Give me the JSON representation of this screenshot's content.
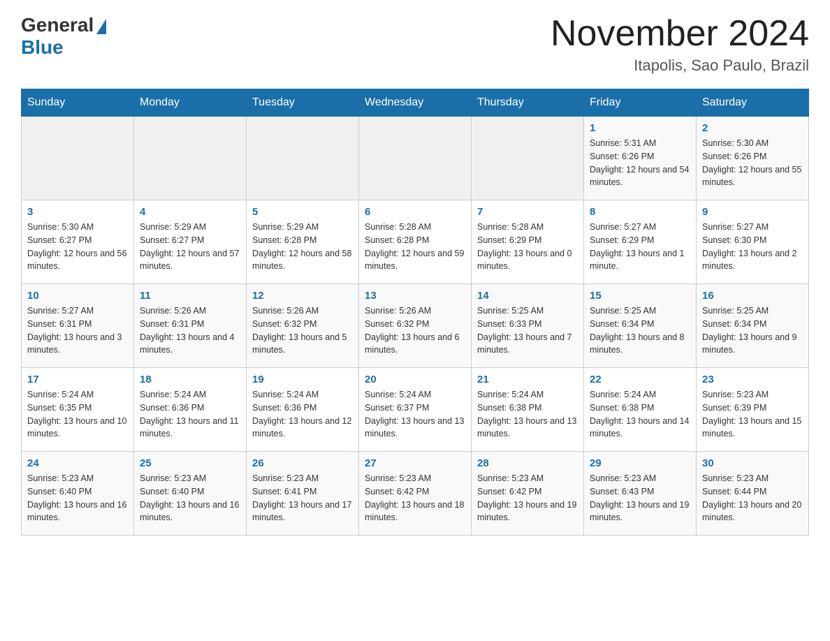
{
  "header": {
    "logo_general": "General",
    "logo_blue": "Blue",
    "month_title": "November 2024",
    "location": "Itapolis, Sao Paulo, Brazil"
  },
  "weekdays": [
    "Sunday",
    "Monday",
    "Tuesday",
    "Wednesday",
    "Thursday",
    "Friday",
    "Saturday"
  ],
  "weeks": [
    [
      {
        "day": "",
        "info": ""
      },
      {
        "day": "",
        "info": ""
      },
      {
        "day": "",
        "info": ""
      },
      {
        "day": "",
        "info": ""
      },
      {
        "day": "",
        "info": ""
      },
      {
        "day": "1",
        "info": "Sunrise: 5:31 AM\nSunset: 6:26 PM\nDaylight: 12 hours and 54 minutes."
      },
      {
        "day": "2",
        "info": "Sunrise: 5:30 AM\nSunset: 6:26 PM\nDaylight: 12 hours and 55 minutes."
      }
    ],
    [
      {
        "day": "3",
        "info": "Sunrise: 5:30 AM\nSunset: 6:27 PM\nDaylight: 12 hours and 56 minutes."
      },
      {
        "day": "4",
        "info": "Sunrise: 5:29 AM\nSunset: 6:27 PM\nDaylight: 12 hours and 57 minutes."
      },
      {
        "day": "5",
        "info": "Sunrise: 5:29 AM\nSunset: 6:28 PM\nDaylight: 12 hours and 58 minutes."
      },
      {
        "day": "6",
        "info": "Sunrise: 5:28 AM\nSunset: 6:28 PM\nDaylight: 12 hours and 59 minutes."
      },
      {
        "day": "7",
        "info": "Sunrise: 5:28 AM\nSunset: 6:29 PM\nDaylight: 13 hours and 0 minutes."
      },
      {
        "day": "8",
        "info": "Sunrise: 5:27 AM\nSunset: 6:29 PM\nDaylight: 13 hours and 1 minute."
      },
      {
        "day": "9",
        "info": "Sunrise: 5:27 AM\nSunset: 6:30 PM\nDaylight: 13 hours and 2 minutes."
      }
    ],
    [
      {
        "day": "10",
        "info": "Sunrise: 5:27 AM\nSunset: 6:31 PM\nDaylight: 13 hours and 3 minutes."
      },
      {
        "day": "11",
        "info": "Sunrise: 5:26 AM\nSunset: 6:31 PM\nDaylight: 13 hours and 4 minutes."
      },
      {
        "day": "12",
        "info": "Sunrise: 5:26 AM\nSunset: 6:32 PM\nDaylight: 13 hours and 5 minutes."
      },
      {
        "day": "13",
        "info": "Sunrise: 5:26 AM\nSunset: 6:32 PM\nDaylight: 13 hours and 6 minutes."
      },
      {
        "day": "14",
        "info": "Sunrise: 5:25 AM\nSunset: 6:33 PM\nDaylight: 13 hours and 7 minutes."
      },
      {
        "day": "15",
        "info": "Sunrise: 5:25 AM\nSunset: 6:34 PM\nDaylight: 13 hours and 8 minutes."
      },
      {
        "day": "16",
        "info": "Sunrise: 5:25 AM\nSunset: 6:34 PM\nDaylight: 13 hours and 9 minutes."
      }
    ],
    [
      {
        "day": "17",
        "info": "Sunrise: 5:24 AM\nSunset: 6:35 PM\nDaylight: 13 hours and 10 minutes."
      },
      {
        "day": "18",
        "info": "Sunrise: 5:24 AM\nSunset: 6:36 PM\nDaylight: 13 hours and 11 minutes."
      },
      {
        "day": "19",
        "info": "Sunrise: 5:24 AM\nSunset: 6:36 PM\nDaylight: 13 hours and 12 minutes."
      },
      {
        "day": "20",
        "info": "Sunrise: 5:24 AM\nSunset: 6:37 PM\nDaylight: 13 hours and 13 minutes."
      },
      {
        "day": "21",
        "info": "Sunrise: 5:24 AM\nSunset: 6:38 PM\nDaylight: 13 hours and 13 minutes."
      },
      {
        "day": "22",
        "info": "Sunrise: 5:24 AM\nSunset: 6:38 PM\nDaylight: 13 hours and 14 minutes."
      },
      {
        "day": "23",
        "info": "Sunrise: 5:23 AM\nSunset: 6:39 PM\nDaylight: 13 hours and 15 minutes."
      }
    ],
    [
      {
        "day": "24",
        "info": "Sunrise: 5:23 AM\nSunset: 6:40 PM\nDaylight: 13 hours and 16 minutes."
      },
      {
        "day": "25",
        "info": "Sunrise: 5:23 AM\nSunset: 6:40 PM\nDaylight: 13 hours and 16 minutes."
      },
      {
        "day": "26",
        "info": "Sunrise: 5:23 AM\nSunset: 6:41 PM\nDaylight: 13 hours and 17 minutes."
      },
      {
        "day": "27",
        "info": "Sunrise: 5:23 AM\nSunset: 6:42 PM\nDaylight: 13 hours and 18 minutes."
      },
      {
        "day": "28",
        "info": "Sunrise: 5:23 AM\nSunset: 6:42 PM\nDaylight: 13 hours and 19 minutes."
      },
      {
        "day": "29",
        "info": "Sunrise: 5:23 AM\nSunset: 6:43 PM\nDaylight: 13 hours and 19 minutes."
      },
      {
        "day": "30",
        "info": "Sunrise: 5:23 AM\nSunset: 6:44 PM\nDaylight: 13 hours and 20 minutes."
      }
    ]
  ]
}
